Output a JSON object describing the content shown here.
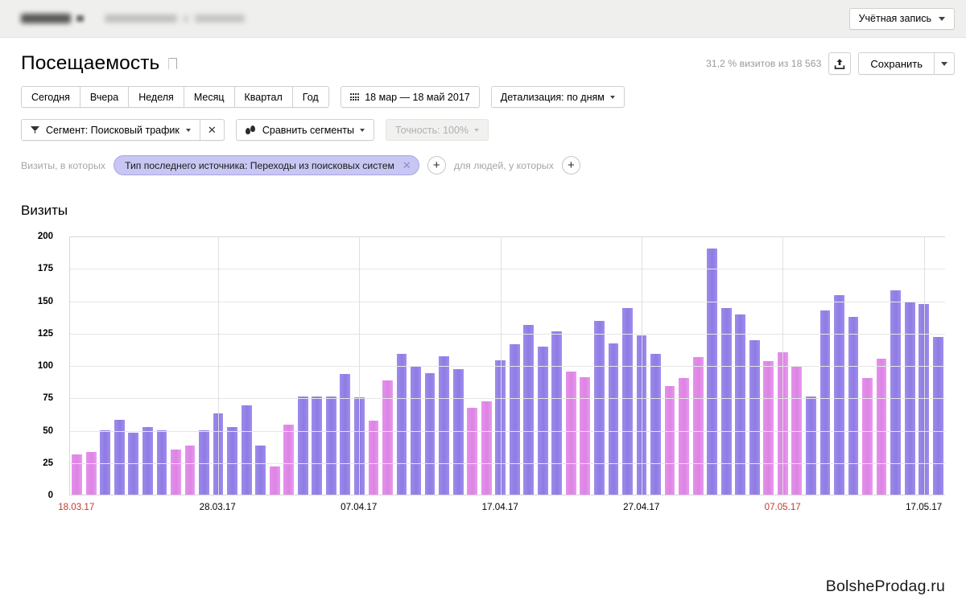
{
  "topbar": {
    "account_button": "Учётная запись",
    "redacted_counter_name": "",
    "redacted_site_host": ""
  },
  "header": {
    "page_title": "Посещаемость",
    "bookmark_icon": "bookmark-icon",
    "visits_share": "31,2 % визитов из 18 563",
    "export_icon": "export-icon",
    "save_label": "Сохранить"
  },
  "period_tabs": [
    {
      "label": "Сегодня"
    },
    {
      "label": "Вчера"
    },
    {
      "label": "Неделя"
    },
    {
      "label": "Месяц"
    },
    {
      "label": "Квартал"
    },
    {
      "label": "Год"
    }
  ],
  "date_range": {
    "icon": "calendar-icon",
    "label": "18 мар — 18 май 2017"
  },
  "detalization": {
    "label": "Детализация: по дням"
  },
  "segment": {
    "icon": "funnel-icon",
    "label": "Сегмент: Поисковый трафик",
    "remove_icon": "close-icon"
  },
  "compare_segments": {
    "icon": "compare-drops-icon",
    "label": "Сравнить сегменты"
  },
  "accuracy": {
    "label": "Точность: 100%"
  },
  "conditions": {
    "prefix_label": "Визиты, в которых",
    "chip_label": "Тип последнего источника: Переходы из поисковых систем",
    "chip_close_icon": "chip-close-icon",
    "add_visit_condition_icon": "plus-icon",
    "middle_label": "для людей, у которых",
    "add_people_condition_icon": "plus-icon"
  },
  "metric": {
    "title": "Визиты"
  },
  "watermark": "BolsheProdag.ru",
  "colors": {
    "weekday_bar": "#9a86e8",
    "weekend_bar": "#e08ae8",
    "chip_bg": "#c8c6f2",
    "highlight_label": "#c23a2e"
  },
  "chart_data": {
    "type": "bar",
    "title": "Визиты",
    "xlabel": "",
    "ylabel": "",
    "ylim": [
      0,
      200
    ],
    "yticks": [
      0,
      25,
      50,
      75,
      100,
      125,
      150,
      175,
      200
    ],
    "grid": true,
    "legend": false,
    "x_tick_labels": [
      {
        "label": "18.03.17",
        "index": 0,
        "highlight": true
      },
      {
        "label": "28.03.17",
        "index": 10,
        "highlight": false
      },
      {
        "label": "07.04.17",
        "index": 20,
        "highlight": false
      },
      {
        "label": "17.04.17",
        "index": 30,
        "highlight": false
      },
      {
        "label": "27.04.17",
        "index": 40,
        "highlight": false
      },
      {
        "label": "07.05.17",
        "index": 50,
        "highlight": true
      },
      {
        "label": "17.05.17",
        "index": 60,
        "highlight": false
      }
    ],
    "categories": [
      "18.03.17",
      "19.03.17",
      "20.03.17",
      "21.03.17",
      "22.03.17",
      "23.03.17",
      "24.03.17",
      "25.03.17",
      "26.03.17",
      "27.03.17",
      "28.03.17",
      "29.03.17",
      "30.03.17",
      "31.03.17",
      "01.04.17",
      "02.04.17",
      "03.04.17",
      "04.04.17",
      "05.04.17",
      "06.04.17",
      "07.04.17",
      "08.04.17",
      "09.04.17",
      "10.04.17",
      "11.04.17",
      "12.04.17",
      "13.04.17",
      "14.04.17",
      "15.04.17",
      "16.04.17",
      "17.04.17",
      "18.04.17",
      "19.04.17",
      "20.04.17",
      "21.04.17",
      "22.04.17",
      "23.04.17",
      "24.04.17",
      "25.04.17",
      "26.04.17",
      "27.04.17",
      "28.04.17",
      "29.04.17",
      "30.04.17",
      "01.05.17",
      "02.05.17",
      "03.05.17",
      "04.05.17",
      "05.05.17",
      "06.05.17",
      "07.05.17",
      "08.05.17",
      "09.05.17",
      "10.05.17",
      "11.05.17",
      "12.05.17",
      "13.05.17",
      "14.05.17",
      "15.05.17",
      "16.05.17",
      "17.05.17",
      "18.05.17"
    ],
    "values": [
      31,
      33,
      50,
      58,
      48,
      52,
      50,
      35,
      38,
      50,
      63,
      52,
      69,
      38,
      22,
      54,
      76,
      76,
      76,
      93,
      75,
      57,
      88,
      109,
      99,
      94,
      107,
      97,
      67,
      72,
      104,
      116,
      131,
      114,
      126,
      95,
      91,
      134,
      117,
      144,
      123,
      109,
      84,
      90,
      106,
      190,
      144,
      139,
      119,
      103,
      110,
      99,
      76,
      142,
      154,
      137,
      90,
      105,
      158,
      149,
      147,
      122
    ],
    "bar_kinds": [
      "weekend",
      "weekend",
      "weekday",
      "weekday",
      "weekday",
      "weekday",
      "weekday",
      "weekend",
      "weekend",
      "weekday",
      "weekday",
      "weekday",
      "weekday",
      "weekday",
      "weekend",
      "weekend",
      "weekday",
      "weekday",
      "weekday",
      "weekday",
      "weekday",
      "weekend",
      "weekend",
      "weekday",
      "weekday",
      "weekday",
      "weekday",
      "weekday",
      "weekend",
      "weekend",
      "weekday",
      "weekday",
      "weekday",
      "weekday",
      "weekday",
      "weekend",
      "weekend",
      "weekday",
      "weekday",
      "weekday",
      "weekday",
      "weekday",
      "weekend",
      "weekend",
      "weekend",
      "weekday",
      "weekday",
      "weekday",
      "weekday",
      "weekend",
      "weekend",
      "weekend",
      "weekday",
      "weekday",
      "weekday",
      "weekday",
      "weekend",
      "weekend",
      "weekday",
      "weekday",
      "weekday",
      "weekday"
    ]
  }
}
